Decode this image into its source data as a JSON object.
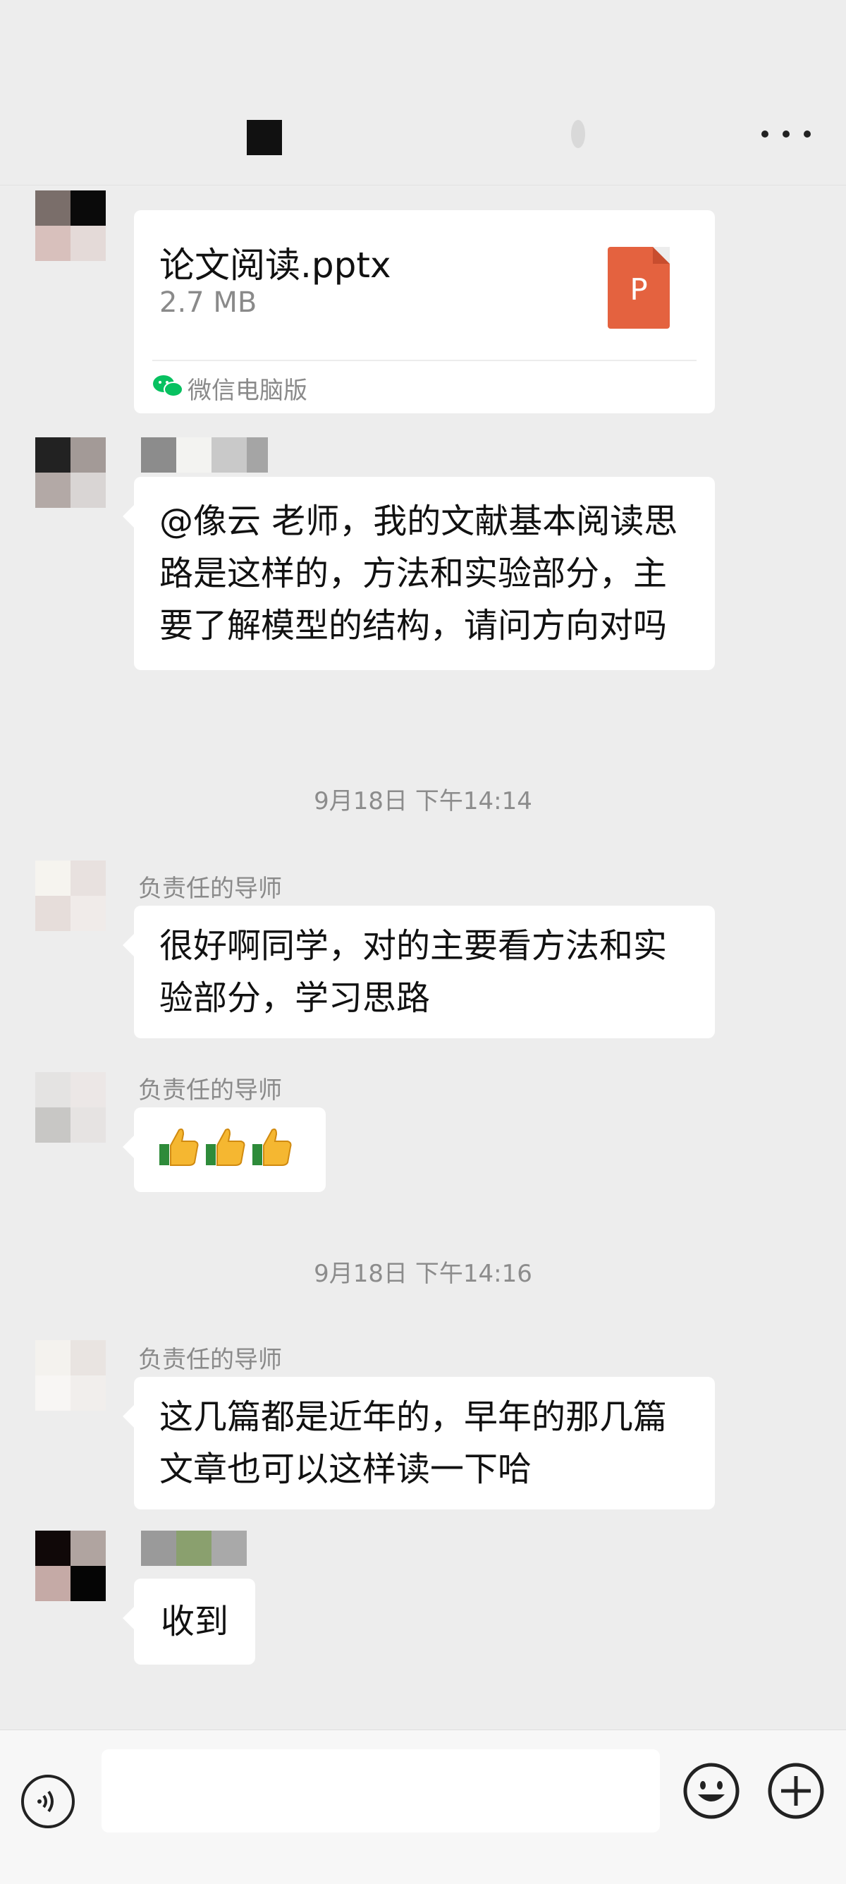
{
  "header": {
    "more_icon": "more-dots-icon"
  },
  "messages": {
    "file": {
      "name": "论文阅读.pptx",
      "size": "2.7 MB",
      "icon_letter": "P",
      "source": "微信电脑版",
      "icon_color": "#e4623f"
    },
    "m1": {
      "text": "@像云  老师，我的文献基本阅读思路是这样的，方法和实验部分，主要了解模型的结构，请问方向对吗"
    },
    "time1": "9月18日 下午14:14",
    "m2": {
      "sender": "负责任的导师",
      "text": "很好啊同学，对的主要看方法和实验部分，学习思路"
    },
    "m3": {
      "sender": "负责任的导师",
      "emoji": "thumbs-up-icon ×3"
    },
    "time2": "9月18日 下午14:16",
    "m4": {
      "sender": "负责任的导师",
      "text": "这几篇都是近年的，早年的那几篇文章也可以这样读一下哈"
    },
    "m5": {
      "text": "收到"
    }
  },
  "input_bar": {
    "voice_icon": "voice-icon",
    "input_value": "",
    "emoji_icon": "smiley-icon",
    "plus_icon": "plus-circle-icon"
  },
  "colors": {
    "background": "#ededed",
    "bubble": "#ffffff",
    "ppt": "#e4623f",
    "wechat_green": "#07c160"
  }
}
